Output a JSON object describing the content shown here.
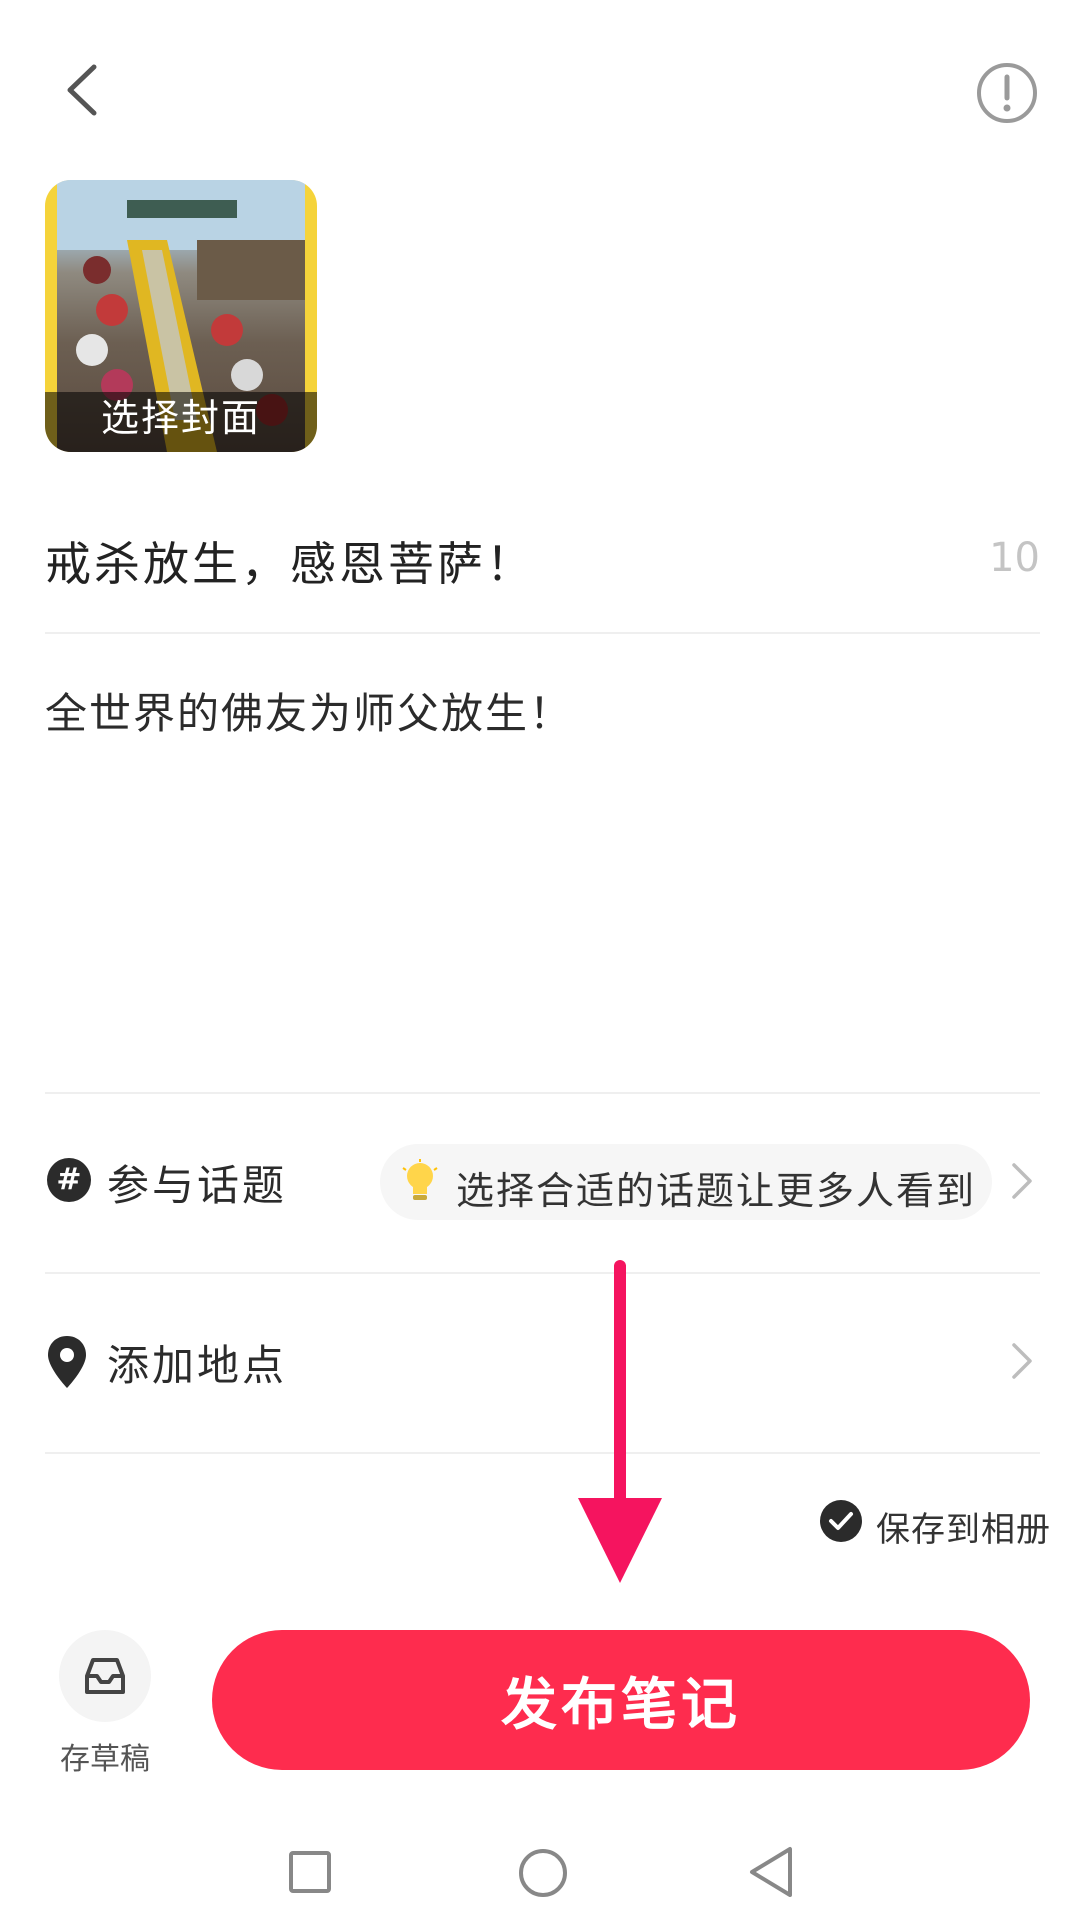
{
  "header": {
    "back_icon": "chevron-left-icon",
    "info_icon": "exclamation-circle-icon"
  },
  "cover": {
    "label": "选择封面"
  },
  "title": {
    "text": "戒杀放生，感恩菩萨！",
    "char_count": "10"
  },
  "body": {
    "text": "全世界的佛友为师父放生！"
  },
  "topic": {
    "label": "参与话题",
    "hint": "选择合适的话题让更多人看到",
    "icon": "hashtag-icon",
    "hint_icon": "lightbulb-icon"
  },
  "location": {
    "label": "添加地点",
    "icon": "location-pin-icon"
  },
  "save_album": {
    "label": "保存到相册",
    "checked": true
  },
  "bottom": {
    "draft_label": "存草稿",
    "publish_label": "发布笔记"
  },
  "colors": {
    "accent": "#fe2c4e",
    "arrow": "#f5145f"
  }
}
